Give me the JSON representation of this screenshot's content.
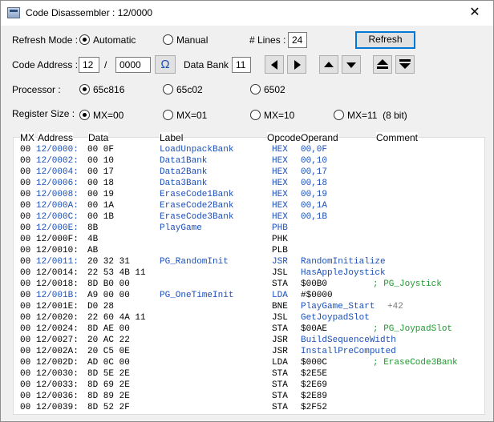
{
  "window": {
    "title": "Code Disassembler : 12/0000",
    "close_glyph": "✕"
  },
  "refresh": {
    "label": "Refresh Mode :",
    "automatic": "Automatic",
    "manual": "Manual",
    "selected": "Automatic",
    "lines_label": "# Lines :",
    "lines_value": "24",
    "button": "Refresh"
  },
  "address": {
    "label": "Code Address :",
    "bank": "12",
    "sep": "/",
    "offset": "0000",
    "omega": "Ω",
    "data_bank_label": "Data Bank :",
    "data_bank": "11"
  },
  "processor": {
    "label": "Processor :",
    "options": [
      "65c816",
      "65c02",
      "6502"
    ],
    "selected": "65c816"
  },
  "register": {
    "label": "Register Size :",
    "options": [
      "MX=00",
      "MX=01",
      "MX=10",
      "MX=11  (8 bit)"
    ],
    "selected": "MX=00"
  },
  "table": {
    "columns": {
      "mx": "MX",
      "address": "Address",
      "data": "Data",
      "label": "Label",
      "opcode": "Opcode",
      "operand": "Operand",
      "comment": "Comment"
    },
    "rows": [
      {
        "mx": "00",
        "addr": "12/0000:",
        "data": "00 0F",
        "label": "LoadUnpackBank",
        "op": "HEX",
        "operand": "00,0F",
        "comment": "",
        "link": true
      },
      {
        "mx": "00",
        "addr": "12/0002:",
        "data": "00 10",
        "label": "Data1Bank",
        "op": "HEX",
        "operand": "00,10",
        "comment": "",
        "link": true
      },
      {
        "mx": "00",
        "addr": "12/0004:",
        "data": "00 17",
        "label": "Data2Bank",
        "op": "HEX",
        "operand": "00,17",
        "comment": "",
        "link": true
      },
      {
        "mx": "00",
        "addr": "12/0006:",
        "data": "00 18",
        "label": "Data3Bank",
        "op": "HEX",
        "operand": "00,18",
        "comment": "",
        "link": true
      },
      {
        "mx": "00",
        "addr": "12/0008:",
        "data": "00 19",
        "label": "EraseCode1Bank",
        "op": "HEX",
        "operand": "00,19",
        "comment": "",
        "link": true
      },
      {
        "mx": "00",
        "addr": "12/000A:",
        "data": "00 1A",
        "label": "EraseCode2Bank",
        "op": "HEX",
        "operand": "00,1A",
        "comment": "",
        "link": true
      },
      {
        "mx": "00",
        "addr": "12/000C:",
        "data": "00 1B",
        "label": "EraseCode3Bank",
        "op": "HEX",
        "operand": "00,1B",
        "comment": "",
        "link": true
      },
      {
        "mx": "00",
        "addr": "12/000E:",
        "data": "8B",
        "label": "PlayGame",
        "op": "PHB",
        "operand": "",
        "comment": "",
        "link": true
      },
      {
        "mx": "00",
        "addr": "12/000F:",
        "data": "4B",
        "label": "",
        "op": "PHK",
        "operand": "",
        "comment": "",
        "link": false
      },
      {
        "mx": "00",
        "addr": "12/0010:",
        "data": "AB",
        "label": "",
        "op": "PLB",
        "operand": "",
        "comment": "",
        "link": false
      },
      {
        "mx": "00",
        "addr": "12/0011:",
        "data": "20 32 31",
        "label": "PG_RandomInit",
        "op": "JSR",
        "operand": "RandomInitialize",
        "comment": "",
        "link": true
      },
      {
        "mx": "00",
        "addr": "12/0014:",
        "data": "22 53 4B 11",
        "label": "",
        "op": "JSL",
        "operand": "HasAppleJoystick",
        "comment": "",
        "link": false
      },
      {
        "mx": "00",
        "addr": "12/0018:",
        "data": "8D B0 00",
        "label": "",
        "op": "STA",
        "operand": "$00B0",
        "comment": "; PG_Joystick",
        "link": false
      },
      {
        "mx": "00",
        "addr": "12/001B:",
        "data": "A9 00 00",
        "label": "PG_OneTimeInit",
        "op": "LDA",
        "operand": "#$0000",
        "comment": "",
        "link": true
      },
      {
        "mx": "00",
        "addr": "12/001E:",
        "data": "D0 28",
        "label": "",
        "op": "BNE",
        "operand": "PlayGame_Start",
        "comment": "+42",
        "link": false
      },
      {
        "mx": "00",
        "addr": "12/0020:",
        "data": "22 60 4A 11",
        "label": "",
        "op": "JSL",
        "operand": "GetJoypadSlot",
        "comment": "",
        "link": false
      },
      {
        "mx": "00",
        "addr": "12/0024:",
        "data": "8D AE 00",
        "label": "",
        "op": "STA",
        "operand": "$00AE",
        "comment": "; PG_JoypadSlot",
        "link": false
      },
      {
        "mx": "00",
        "addr": "12/0027:",
        "data": "20 AC 22",
        "label": "",
        "op": "JSR",
        "operand": "BuildSequenceWidth",
        "comment": "",
        "link": false
      },
      {
        "mx": "00",
        "addr": "12/002A:",
        "data": "20 C5 0E",
        "label": "",
        "op": "JSR",
        "operand": "InstallPreComputed",
        "comment": "",
        "link": false
      },
      {
        "mx": "00",
        "addr": "12/002D:",
        "data": "AD 0C 00",
        "label": "",
        "op": "LDA",
        "operand": "$000C",
        "comment": "; EraseCode3Bank",
        "link": false
      },
      {
        "mx": "00",
        "addr": "12/0030:",
        "data": "8D 5E 2E",
        "label": "",
        "op": "STA",
        "operand": "$2E5E",
        "comment": "",
        "link": false
      },
      {
        "mx": "00",
        "addr": "12/0033:",
        "data": "8D 69 2E",
        "label": "",
        "op": "STA",
        "operand": "$2E69",
        "comment": "",
        "link": false
      },
      {
        "mx": "00",
        "addr": "12/0036:",
        "data": "8D 89 2E",
        "label": "",
        "op": "STA",
        "operand": "$2E89",
        "comment": "",
        "link": false
      },
      {
        "mx": "00",
        "addr": "12/0039:",
        "data": "8D 52 2F",
        "label": "",
        "op": "STA",
        "operand": "$2F52",
        "comment": "",
        "link": false
      }
    ]
  },
  "colors": {
    "link": "#1c4fb8",
    "comment": "#1e9a2e",
    "offset": "#7a7a7a"
  },
  "icons": [
    "app-icon",
    "close-icon",
    "omega-icon",
    "arrow-left-icon",
    "arrow-right-icon",
    "arrow-up-icon",
    "arrow-down-icon",
    "page-up-icon",
    "page-down-icon"
  ]
}
